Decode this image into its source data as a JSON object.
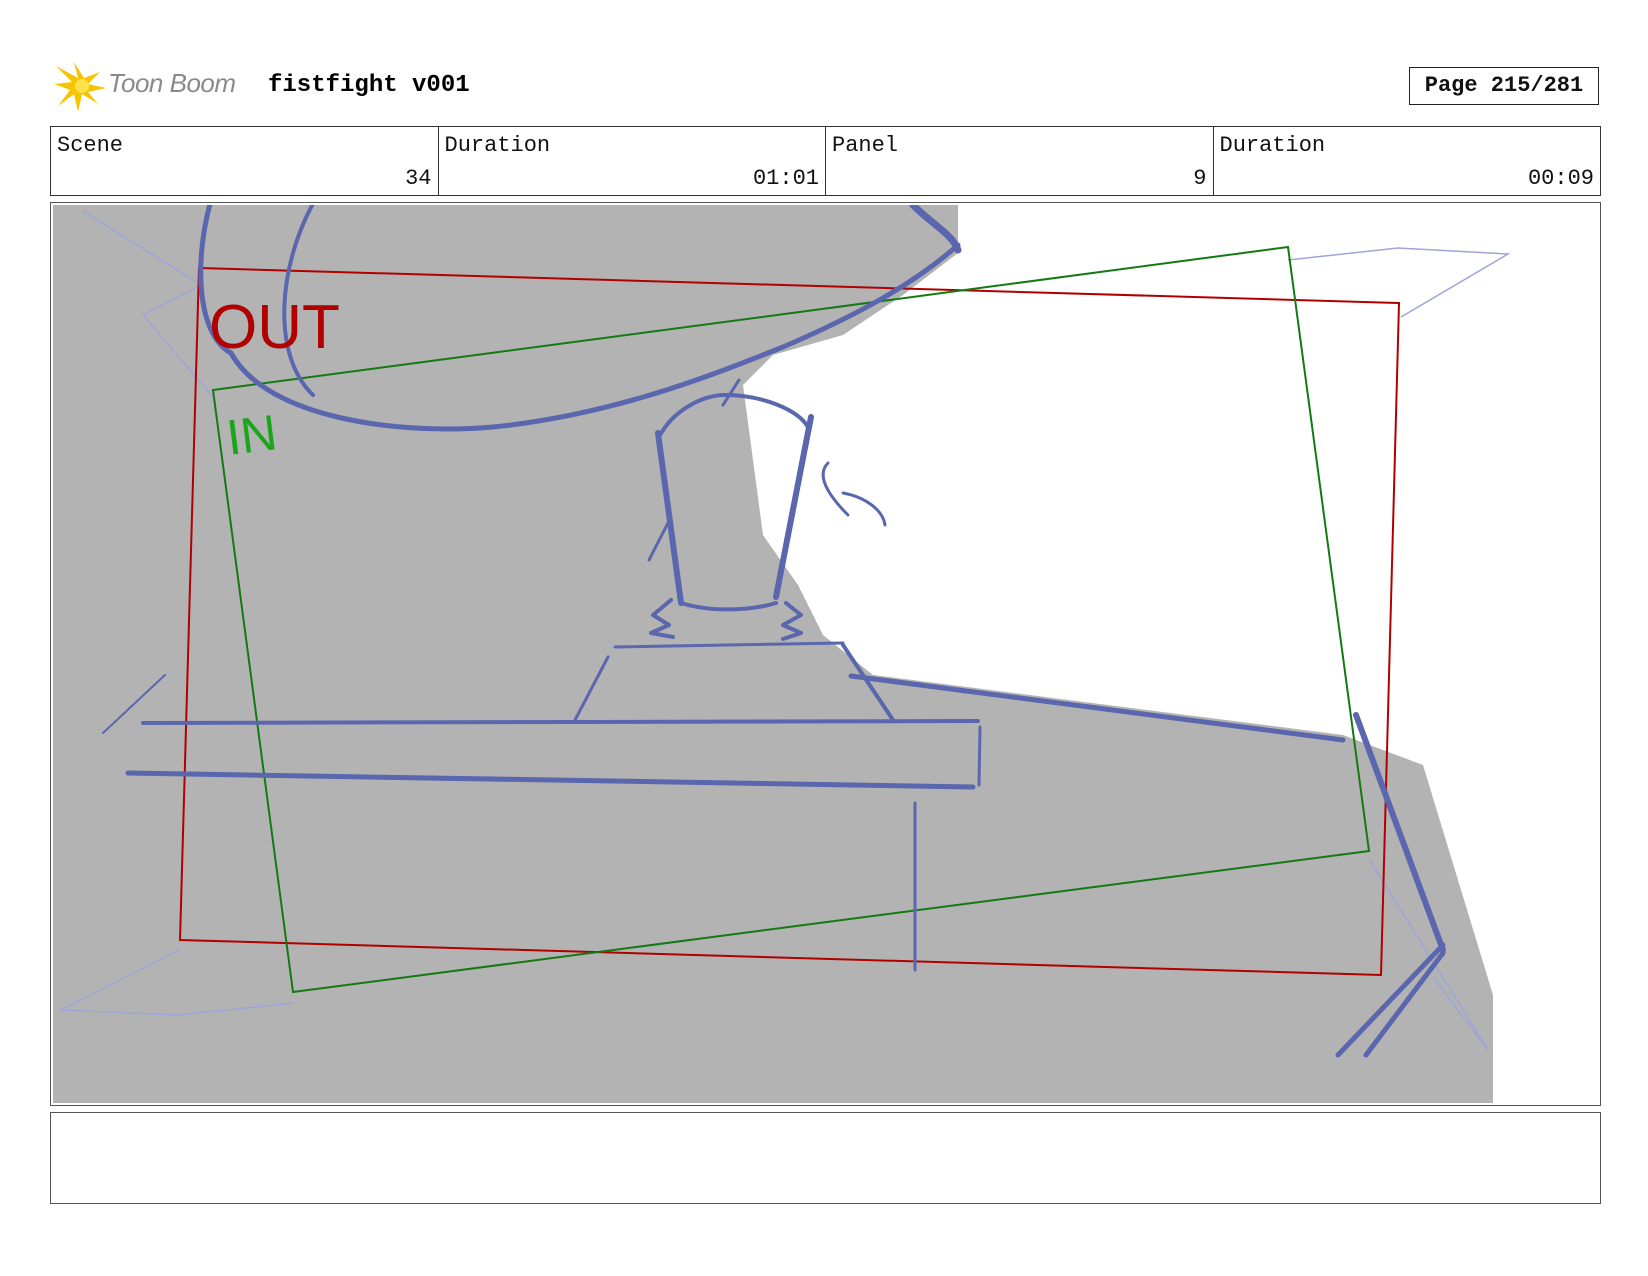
{
  "header": {
    "logo_text": "Toon Boom",
    "project_title": "fistfight v001",
    "page_label": "Page 215/281"
  },
  "info": [
    {
      "label": "Scene",
      "value": "34"
    },
    {
      "label": "Duration",
      "value": "01:01"
    },
    {
      "label": "Panel",
      "value": "9"
    },
    {
      "label": "Duration",
      "value": "00:09"
    }
  ],
  "panel": {
    "out_label": "OUT",
    "in_label": "IN",
    "colors": {
      "background": "#b3b3b3",
      "sketch": "#5a66ad",
      "out_frame": "#b00000",
      "in_frame": "#137a13",
      "in_text": "#1aa51a",
      "guide": "#9ea5d8"
    }
  },
  "dialog": ""
}
